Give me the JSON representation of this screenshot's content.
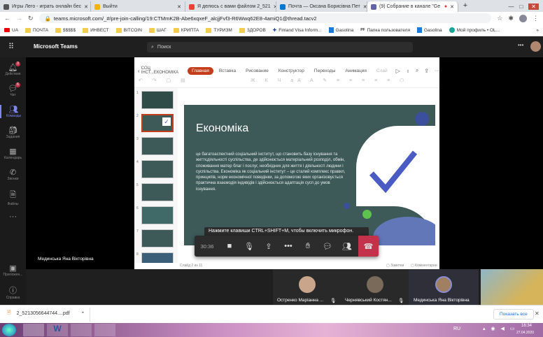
{
  "browser": {
    "tabs": [
      {
        "title": "Игры Лего - играть онлайн бес",
        "color": "#555"
      },
      {
        "title": "Выйти",
        "color": "#f4b400"
      },
      {
        "title": "Я делюсь с вами файлом 2_521",
        "color": "#ea4335"
      },
      {
        "title": "Почта — Оксана Борисівна Пет",
        "color": "#0078d4"
      },
      {
        "title": "(9) Собрание в канале \"Ge",
        "color": "#6264a7"
      }
    ],
    "url": "teams.microsoft.com/_#/pre-join-calling/19:CTMmK2B-Abe6xqxeF_alcjjFvf3-R6Wwq62E8-4amiQ1@thread.tacv2",
    "bookmarks": [
      "UA",
      "ПОЧТА",
      "$$$$$",
      "ИНВЕСТ",
      "BITCOIN",
      "ШАГ",
      "КРИПТА",
      "ТУРИЗМ",
      "ЗДОРОВ",
      "Finland Visa Inform...",
      "Gasolina",
      "Папка пользователя",
      "Gasolina",
      "Мой профиль • OL..."
    ]
  },
  "teams": {
    "app_title": "Microsoft Teams",
    "search_placeholder": "Поиск",
    "rail": [
      {
        "label": "Действия",
        "icon": "bell-icon",
        "badge": "3"
      },
      {
        "label": "Чат",
        "icon": "chat-icon",
        "badge": "6"
      },
      {
        "label": "Команды",
        "icon": "teams-icon"
      },
      {
        "label": "Задания",
        "icon": "backpack-icon"
      },
      {
        "label": "Календарь",
        "icon": "calendar-icon"
      },
      {
        "label": "Звонки",
        "icon": "phone-icon"
      },
      {
        "label": "Файлы",
        "icon": "file-icon"
      },
      {
        "label": "Приложен...",
        "icon": "apps-icon"
      },
      {
        "label": "Справка",
        "icon": "help-icon"
      }
    ],
    "presenter_name": "Мединська Яна Вікторівна"
  },
  "ppt": {
    "file_name": "СОЦ ІНСТ...ЕКОНОМІКА",
    "ribbon_tabs": [
      "Главная",
      "Вставка",
      "Рисование",
      "Конструктор",
      "Переходы",
      "Анимация",
      "Слай"
    ],
    "slide_numbers": [
      "1",
      "2",
      "3",
      "4",
      "5",
      "6",
      "7",
      "8"
    ],
    "slide": {
      "title": "Економіка",
      "body": "це багатоаспектний соціальний інститут, що становить базу існування та життєдіяльності суспільства, де здійснюється матеріальний розподіл, обмін, споживання матер благ і послуг, необхідних для життя і діяльності людини і суспільства. Економіка як соціальний інститут – це сталий комплекс правил, принципів, норм економічної поведінки, за допомогою яких організовується практична взаємодія індивідів і здійснюється адаптація сусп до умов існування."
    },
    "status": "Слайд 2 из 11",
    "notes": "Заметки",
    "comments": "Комментарии"
  },
  "call": {
    "tooltip": "Нажмите клавиши CTRL+SHIFT+M, чтобы включить микрофон.",
    "timer": "30:36",
    "participants": [
      "Остренко Маріанна ...",
      "Чернявський Костян...",
      "Мединська Яна Вікторівна"
    ]
  },
  "download": {
    "file": "2_5213056644744....pdf",
    "show_all": "Показать все"
  },
  "taskbar": {
    "lang": "RU",
    "time": "16:34",
    "date": "27.04.2020"
  }
}
